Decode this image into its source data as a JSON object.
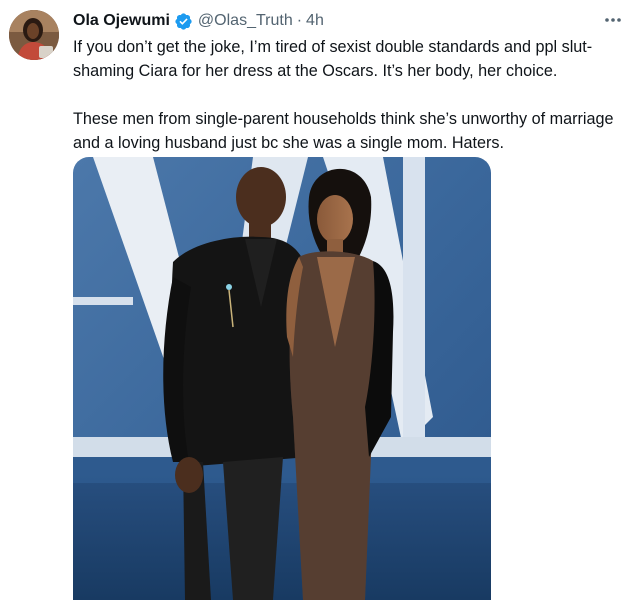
{
  "tweet": {
    "author_name": "Ola Ojewumi",
    "handle": "@Olas_Truth",
    "separator": "·",
    "time": "4h",
    "paragraphs": [
      "If you don’t get the joke, I’m tired of sexist double standards and ppl slut-shaming Ciara for her dress at the Oscars. It’s her body, her choice.",
      "These men from single-parent households think she’s unworthy of marriage and a loving husband just bc she was a single mom. Haters."
    ]
  },
  "icons": {
    "verified": "verified-badge-icon",
    "more": "more-options-icon"
  },
  "colors": {
    "text": "#0f1419",
    "secondary": "#536471",
    "verified": "#1d9bf0",
    "backdrop": "#3f6a9e",
    "carpet": "#21456f"
  }
}
